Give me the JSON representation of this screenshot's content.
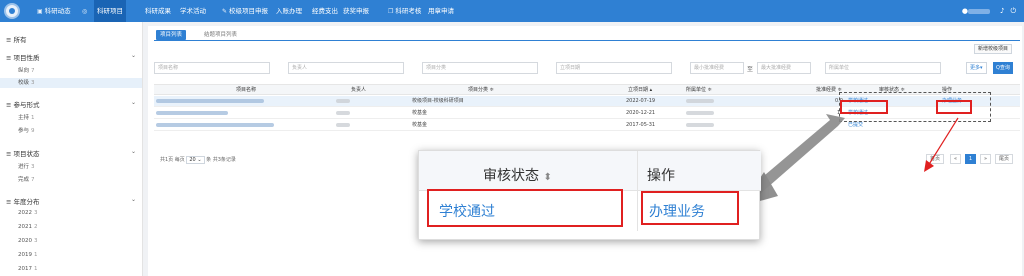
{
  "topnav": {
    "items": [
      {
        "label": "科研动态",
        "icon": "chart-icon",
        "active": false
      },
      {
        "label": "科研项目",
        "icon": "circle-check-icon",
        "active": true
      },
      {
        "label": "科研成果",
        "icon": "",
        "active": false
      },
      {
        "label": "学术活动",
        "icon": "",
        "active": false
      },
      {
        "label": "校级项目申报",
        "icon": "edit-icon",
        "active": false
      },
      {
        "label": "入账办理",
        "icon": "",
        "active": false
      },
      {
        "label": "经费支出",
        "icon": "",
        "active": false
      },
      {
        "label": "获奖申报",
        "icon": "",
        "active": false
      },
      {
        "label": "科研考核",
        "icon": "copy-icon",
        "active": false
      },
      {
        "label": "用章申请",
        "icon": "",
        "active": false
      }
    ],
    "user_icon": "user-icon",
    "bell_icon": "bell-icon",
    "power_icon": "power-icon"
  },
  "sidebar": {
    "all_label": "所有",
    "groups": [
      {
        "label": "项目性质",
        "children": [
          {
            "label": "纵向",
            "count": "7"
          },
          {
            "label": "校级",
            "count": "3",
            "active": true
          }
        ]
      },
      {
        "label": "参与形式",
        "children": [
          {
            "label": "主持",
            "count": "1"
          },
          {
            "label": "参与",
            "count": "9"
          }
        ]
      },
      {
        "label": "项目状态",
        "children": [
          {
            "label": "进行",
            "count": "3"
          },
          {
            "label": "完成",
            "count": "7"
          }
        ]
      },
      {
        "label": "年度分布",
        "children": [
          {
            "label": "2022",
            "count": "3"
          },
          {
            "label": "2021",
            "count": "2"
          },
          {
            "label": "2020",
            "count": "3"
          },
          {
            "label": "2019",
            "count": "1"
          },
          {
            "label": "2017",
            "count": "1"
          }
        ]
      }
    ]
  },
  "main": {
    "tabs": [
      {
        "label": "项目列表"
      },
      {
        "label": "结题项目列表"
      }
    ],
    "new_button": "新增校级项目",
    "filters": {
      "name": "项目名称",
      "leader": "负责人",
      "category": "项目分类",
      "date": "立项日期",
      "min_fund": "最小批准经费",
      "max_fund": "最大批准经费",
      "unit": "所属单位",
      "tilde": "至"
    },
    "more_button": "更多▾",
    "query_button": "Q查询",
    "columns": {
      "name": "项目名称",
      "leader": "负责人",
      "category": "项目分类 ≑",
      "date": "立项日期 ▴",
      "unit": "所属单位 ≑",
      "fund": "批准经费 ≑",
      "status": "审核状态 ≑",
      "action": "操作"
    },
    "rows": [
      {
        "category": "校级项目-校级科研项目",
        "date": "2022-07-19",
        "fund": "0.0",
        "status": "学校通过",
        "action": "办理业务"
      },
      {
        "category": "校基金",
        "date": "2020-12-21",
        "fund": "1.",
        "status": "学校通过",
        "action": ""
      },
      {
        "category": "校基金",
        "date": "2017-05-31",
        "fund": "",
        "status": "已提交",
        "action": ""
      }
    ],
    "pagination": {
      "info_prefix": "共1页 每页",
      "page_size": "20",
      "info_suffix": "条 共3条记录",
      "first": "首页",
      "prev": "«",
      "current": "1",
      "next": "»",
      "last": "尾页"
    }
  },
  "zoom_callout": {
    "status_header": "审核状态",
    "action_header": "操作",
    "status_value": "学校通过",
    "action_value": "办理业务"
  },
  "colors": {
    "primary": "#2f80d3",
    "highlight": "#e02020"
  }
}
